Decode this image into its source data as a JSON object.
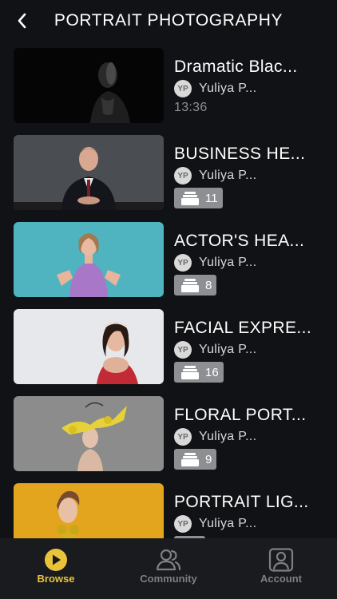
{
  "header": {
    "title": "PORTRAIT PHOTOGRAPHY"
  },
  "courses": [
    {
      "title": "Dramatic Blac...",
      "avatar": "YP",
      "author": "Yuliya P...",
      "duration": "13:36"
    },
    {
      "title": "BUSINESS HE...",
      "avatar": "YP",
      "author": "Yuliya P...",
      "count": "11"
    },
    {
      "title": "ACTOR'S HEA...",
      "avatar": "YP",
      "author": "Yuliya P...",
      "count": "8"
    },
    {
      "title": "FACIAL EXPRE...",
      "avatar": "YP",
      "author": "Yuliya P...",
      "count": "16"
    },
    {
      "title": "FLORAL PORT...",
      "avatar": "YP",
      "author": "Yuliya P...",
      "count": "9"
    },
    {
      "title": "PORTRAIT LIG...",
      "avatar": "YP",
      "author": "Yuliya P..."
    }
  ],
  "tabs": [
    {
      "label": "Browse",
      "icon": "play-circle-icon",
      "active": true
    },
    {
      "label": "Community",
      "icon": "people-icon",
      "active": false
    },
    {
      "label": "Account",
      "icon": "account-icon",
      "active": false
    }
  ],
  "colors": {
    "accent": "#e9c43a",
    "background": "#101215",
    "tabbar": "#191b1f",
    "badge": "#8e8f93"
  }
}
